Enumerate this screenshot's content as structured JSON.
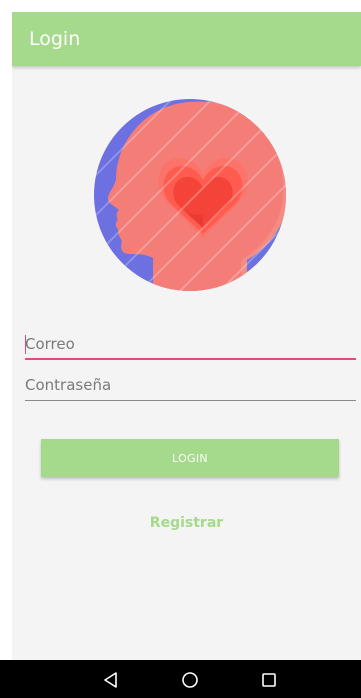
{
  "app_bar": {
    "title": "Login"
  },
  "logo": {
    "icon": "head-heart-logo",
    "colors": {
      "circle": "#6c70e0",
      "head": "#f4857f",
      "heart_dark": "#ff4a3f",
      "heart_light": "#ff7a6e"
    }
  },
  "form": {
    "email": {
      "value": "",
      "placeholder": "Correo"
    },
    "password": {
      "value": "",
      "placeholder": "Contraseña"
    },
    "login_label": "LOGIN",
    "register_label": "Registrar"
  },
  "theme": {
    "primary": "#a5d98b",
    "accent": "#e8467c",
    "background": "#f4f4f4"
  },
  "navigation_bar": {
    "back_icon": "back-triangle-icon",
    "home_icon": "home-circle-icon",
    "recents_icon": "recents-square-icon"
  }
}
